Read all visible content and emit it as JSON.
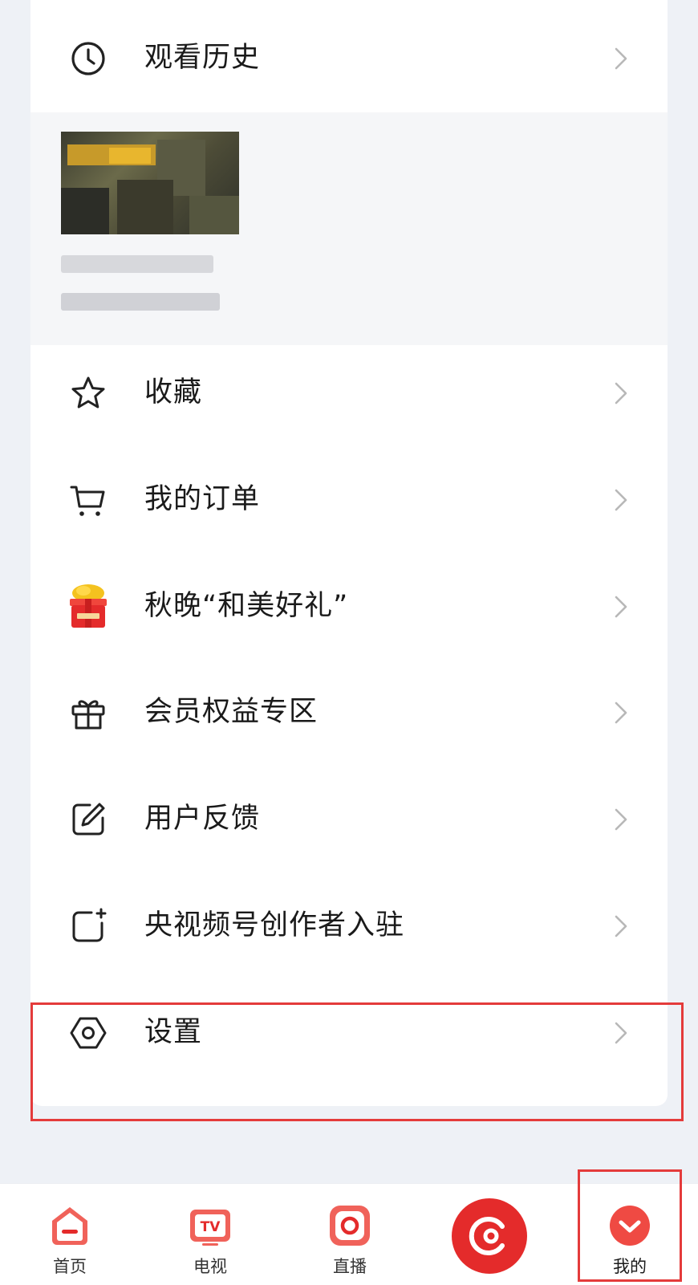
{
  "menu": {
    "watch_history": "观看历史",
    "favorites": "收藏",
    "my_orders": "我的订单",
    "gala_gifts": "秋晚“和美好礼”",
    "member_zone": "会员权益专区",
    "feedback": "用户反馈",
    "creator_join": "央视频号创作者入驻",
    "settings": "设置"
  },
  "tabbar": {
    "home": "首页",
    "tv": "电视",
    "live": "直播",
    "mine": "我的"
  },
  "colors": {
    "accent": "#e42b2b",
    "highlight": "#e43b3b",
    "background": "#eef1f6"
  }
}
